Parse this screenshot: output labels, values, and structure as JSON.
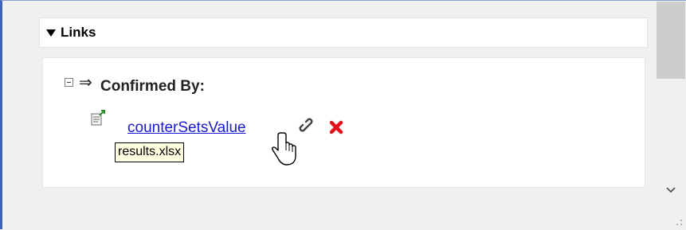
{
  "links_section": {
    "title": "Links",
    "group": {
      "label": "Confirmed By:",
      "arrow": "⇒"
    },
    "item": {
      "link_label": "counterSetsValue",
      "tooltip": "results.xlsx"
    }
  },
  "icons": {
    "section_toggle": "triangle-down-icon",
    "tree_toggle": "minus-box-icon",
    "relation": "right-double-arrow-icon",
    "requirement": "document-link-icon",
    "link": "chain-link-icon",
    "delete": "red-x-icon",
    "cursor": "hand-pointer-icon",
    "scroll_down": "chevron-down-icon"
  },
  "colors": {
    "link": "#1a1ad0",
    "delete": "#e0101a",
    "tooltip_bg": "#ffffe1",
    "accent_border": "#3c63b4"
  }
}
